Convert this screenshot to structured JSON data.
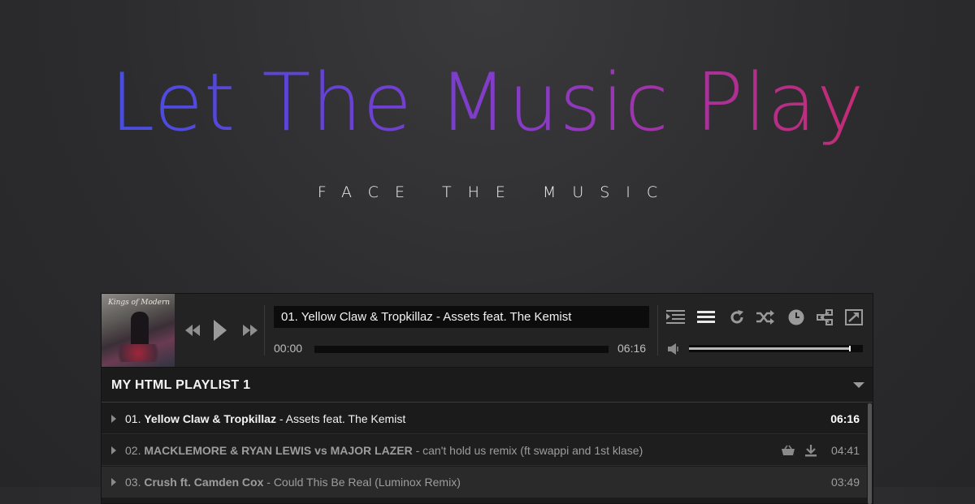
{
  "hero": {
    "title": "Let The Music Play",
    "subtitle": "FACE THE MUSIC"
  },
  "player": {
    "cover_text": "Kings of Modern",
    "now_playing": "01. Yellow Claw & Tropkillaz - Assets feat. The Kemist",
    "time_current": "00:00",
    "time_total": "06:16",
    "progress": 0.0,
    "volume": 0.92,
    "buttons": {
      "prev": "rewind-icon",
      "play": "play-icon",
      "next": "fast-forward-icon",
      "queue": "indent-list-icon",
      "playlist": "list-icon",
      "repeat": "repeat-icon",
      "shuffle": "shuffle-icon",
      "timer": "clock-icon",
      "share": "share-icon",
      "popup": "external-window-icon",
      "volume": "volume-icon"
    }
  },
  "playlist": {
    "name": "MY HTML PLAYLIST 1",
    "tracks": [
      {
        "num": "01.",
        "artist": "Yellow Claw & Tropkillaz",
        "title": " - Assets feat. The Kemist",
        "duration": "06:16",
        "active": true
      },
      {
        "num": "02.",
        "artist": "MACKLEMORE & RYAN LEWIS vs MAJOR LAZER",
        "title": " - can't hold us remix (ft swappi and 1st klase)",
        "duration": "04:41",
        "active": false
      },
      {
        "num": "03.",
        "artist": "Crush ft. Camden Cox",
        "title": " - Could This Be Real (Luminox Remix)",
        "duration": "03:49",
        "active": false
      }
    ]
  },
  "colors": {
    "gradient_start": "#3b55e6",
    "gradient_end": "#d8285c",
    "panel": "#232324",
    "accent_text": "#f2f2f2"
  }
}
